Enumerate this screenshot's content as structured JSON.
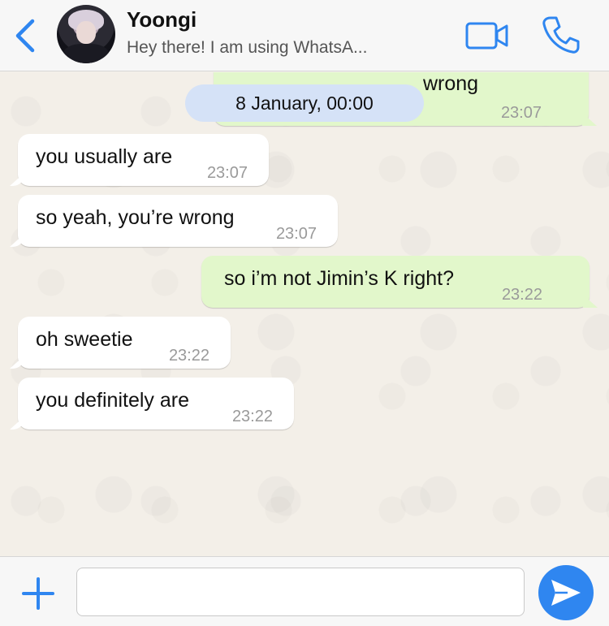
{
  "header": {
    "contact_name": "Yoongi",
    "contact_status": "Hey there! I am using WhatsA...",
    "back_icon": "chevron-left-icon",
    "video_icon": "video-camera-icon",
    "call_icon": "phone-icon"
  },
  "chat": {
    "date_separator": "8 January, 00:00",
    "messages": [
      {
        "direction": "out",
        "text": "wrong",
        "time": "23:07"
      },
      {
        "direction": "in",
        "text": "you usually are",
        "time": "23:07"
      },
      {
        "direction": "in",
        "text": "so yeah, you’re wrong",
        "time": "23:07"
      },
      {
        "direction": "out",
        "text": "so i’m not Jimin’s K right?",
        "time": "23:22"
      },
      {
        "direction": "in",
        "text": "oh sweetie",
        "time": "23:22"
      },
      {
        "direction": "in",
        "text": "you definitely are",
        "time": "23:22"
      }
    ]
  },
  "input": {
    "value": "",
    "add_icon": "plus-icon",
    "send_icon": "send-arrow-icon"
  },
  "colors": {
    "accent": "#2f86f0",
    "outgoing_bubble": "#e2f7cb",
    "incoming_bubble": "#ffffff",
    "date_pill": "#d5e2f7"
  }
}
